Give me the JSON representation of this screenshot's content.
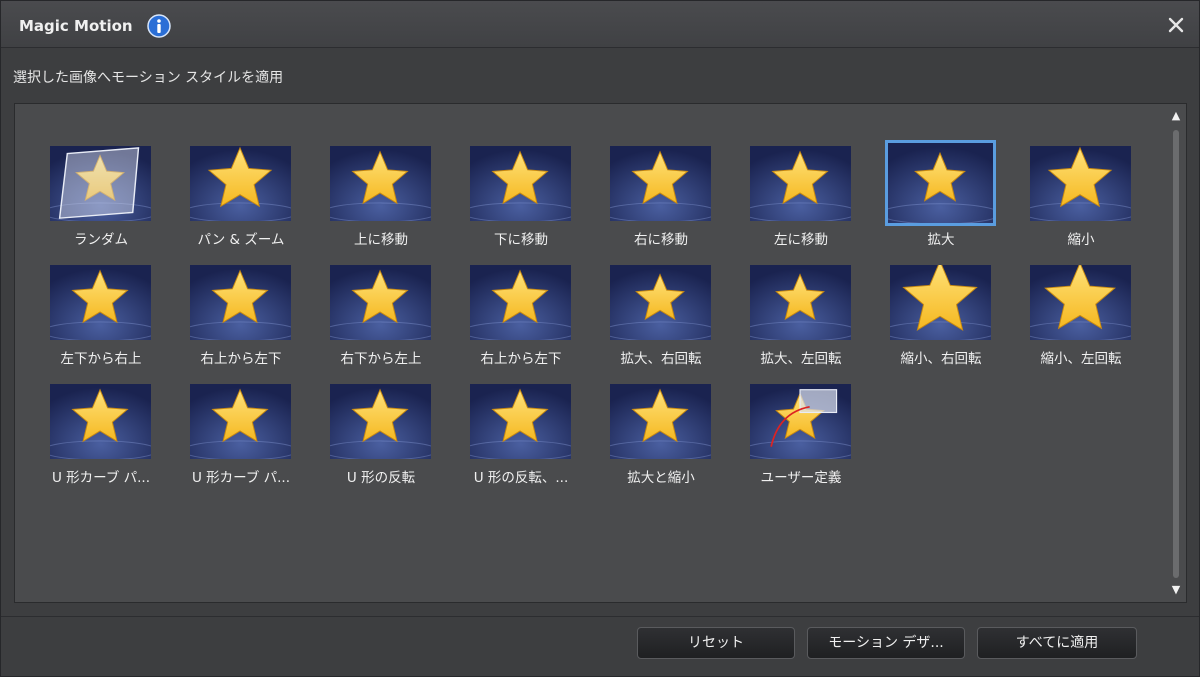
{
  "window": {
    "title": "Magic Motion"
  },
  "subtitle": "選択した画像へモーション スタイルを適用",
  "icons": {
    "info": "info-icon",
    "close": "close-icon",
    "scroll_up": "triangle-up",
    "scroll_down": "triangle-down"
  },
  "colors": {
    "selection": "#5a9de0",
    "thumb_background": "#1a2350",
    "star": "#f5b820"
  },
  "styles": [
    {
      "label": "ランダム",
      "selected": false
    },
    {
      "label": "パン & ズーム",
      "selected": false
    },
    {
      "label": "上に移動",
      "selected": false
    },
    {
      "label": "下に移動",
      "selected": false
    },
    {
      "label": "右に移動",
      "selected": false
    },
    {
      "label": "左に移動",
      "selected": false
    },
    {
      "label": "拡大",
      "selected": true
    },
    {
      "label": "縮小",
      "selected": false
    },
    {
      "label": "左下から右上",
      "selected": false
    },
    {
      "label": "右上から左下",
      "selected": false
    },
    {
      "label": "右下から左上",
      "selected": false
    },
    {
      "label": "右上から左下",
      "selected": false
    },
    {
      "label": "拡大、右回転",
      "selected": false
    },
    {
      "label": "拡大、左回転",
      "selected": false
    },
    {
      "label": "縮小、右回転",
      "selected": false
    },
    {
      "label": "縮小、左回転",
      "selected": false
    },
    {
      "label": "U 形カーブ パ...",
      "selected": false
    },
    {
      "label": "U 形カーブ パ...",
      "selected": false
    },
    {
      "label": "U 形の反転",
      "selected": false
    },
    {
      "label": "U 形の反転、...",
      "selected": false
    },
    {
      "label": "拡大と縮小",
      "selected": false
    },
    {
      "label": "ユーザー定義",
      "selected": false
    }
  ],
  "buttons": {
    "reset": "リセット",
    "motion_designer": "モーション デザ...",
    "apply_all": "すべてに適用"
  }
}
